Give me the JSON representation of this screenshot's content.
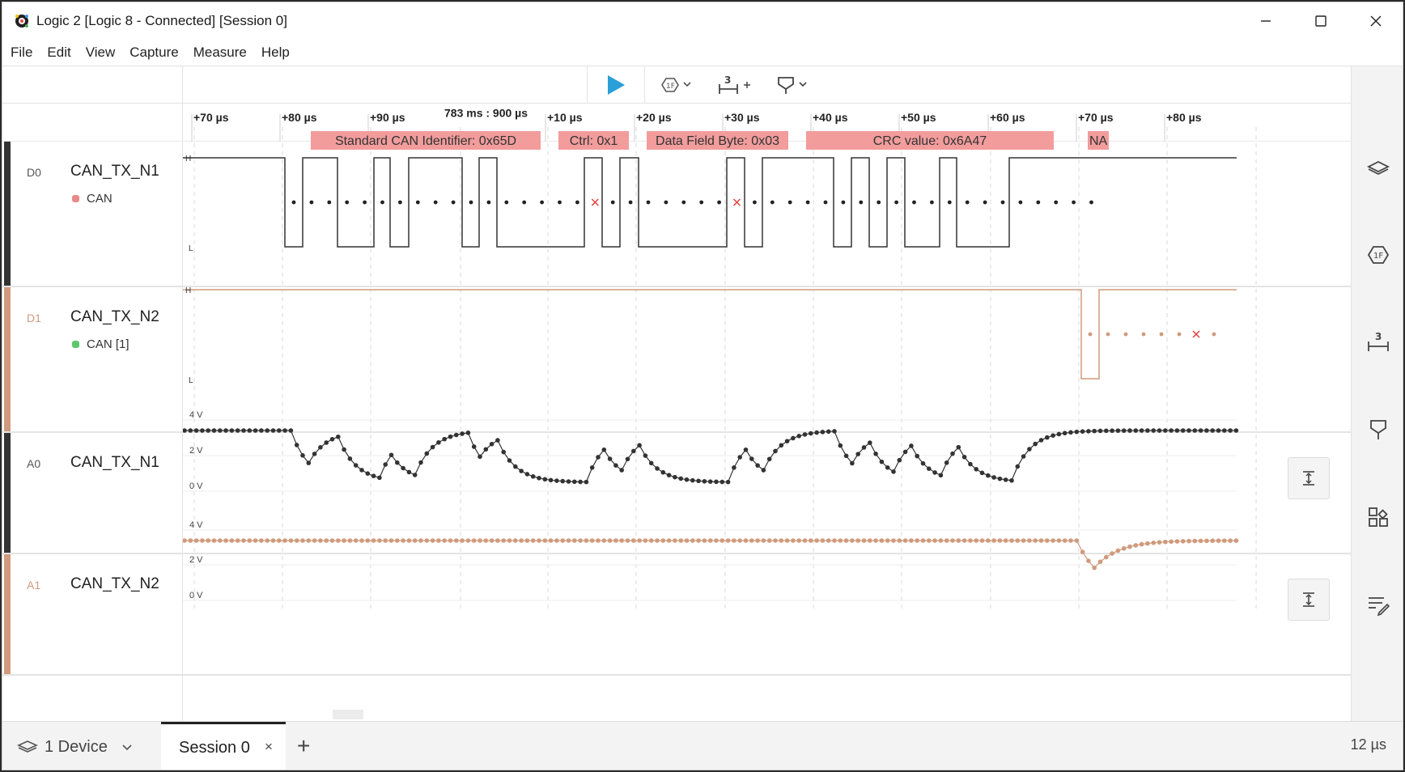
{
  "window": {
    "title": "Logic 2 [Logic 8 - Connected] [Session 0]",
    "controls": [
      "minimize-icon",
      "maximize-icon",
      "close-icon"
    ]
  },
  "menu": [
    "File",
    "Edit",
    "View",
    "Capture",
    "Measure",
    "Help"
  ],
  "toolbar": {
    "play_icon": "play-icon",
    "analyzer_icon": "analyzer-icon",
    "measure_icon": "measure-icon",
    "trigger_icon": "trigger-icon",
    "colors": {
      "play": "#2a9fd8"
    }
  },
  "timeline": {
    "cursor_label": "783 ms : 900 µs",
    "ticks": [
      "+70 µs",
      "+80 µs",
      "+90 µs",
      "",
      "+10 µs",
      "+20 µs",
      "+30 µs",
      "+40 µs",
      "+50 µs",
      "+60 µs",
      "+70 µs",
      "+80 µs"
    ]
  },
  "channels": [
    {
      "id": "D0",
      "name": "CAN_TX_N1",
      "analyzer": "CAN",
      "analyzer_color": "#e88a8a",
      "color": "#333333",
      "levels": {
        "high": "H",
        "low": "L"
      },
      "frames": [
        "Standard CAN Identifier: 0x65D",
        "Ctrl: 0x1",
        "Data Field Byte: 0x03",
        "CRC value: 0x6A47",
        "NA"
      ]
    },
    {
      "id": "D1",
      "name": "CAN_TX_N2",
      "analyzer": "CAN [1]",
      "analyzer_color": "#5cc86e",
      "color": "#d09a7c",
      "levels": {
        "high": "H",
        "low": "L"
      }
    },
    {
      "id": "A0",
      "name": "CAN_TX_N1",
      "color": "#333333",
      "axis": [
        "4 V",
        "2 V",
        "0 V"
      ]
    },
    {
      "id": "A1",
      "name": "CAN_TX_N2",
      "color": "#d09a7c",
      "axis": [
        "4 V",
        "2 V",
        "0 V"
      ]
    }
  ],
  "sidebar_icons": [
    "device-icon",
    "analyzers-icon",
    "measurements-icon",
    "markers-icon",
    "extensions-icon",
    "notes-icon"
  ],
  "bottom": {
    "device_tab": "1 Device",
    "session_tab": "Session 0",
    "close_symbol": "×",
    "add_symbol": "+",
    "timescale": "12 µs"
  }
}
